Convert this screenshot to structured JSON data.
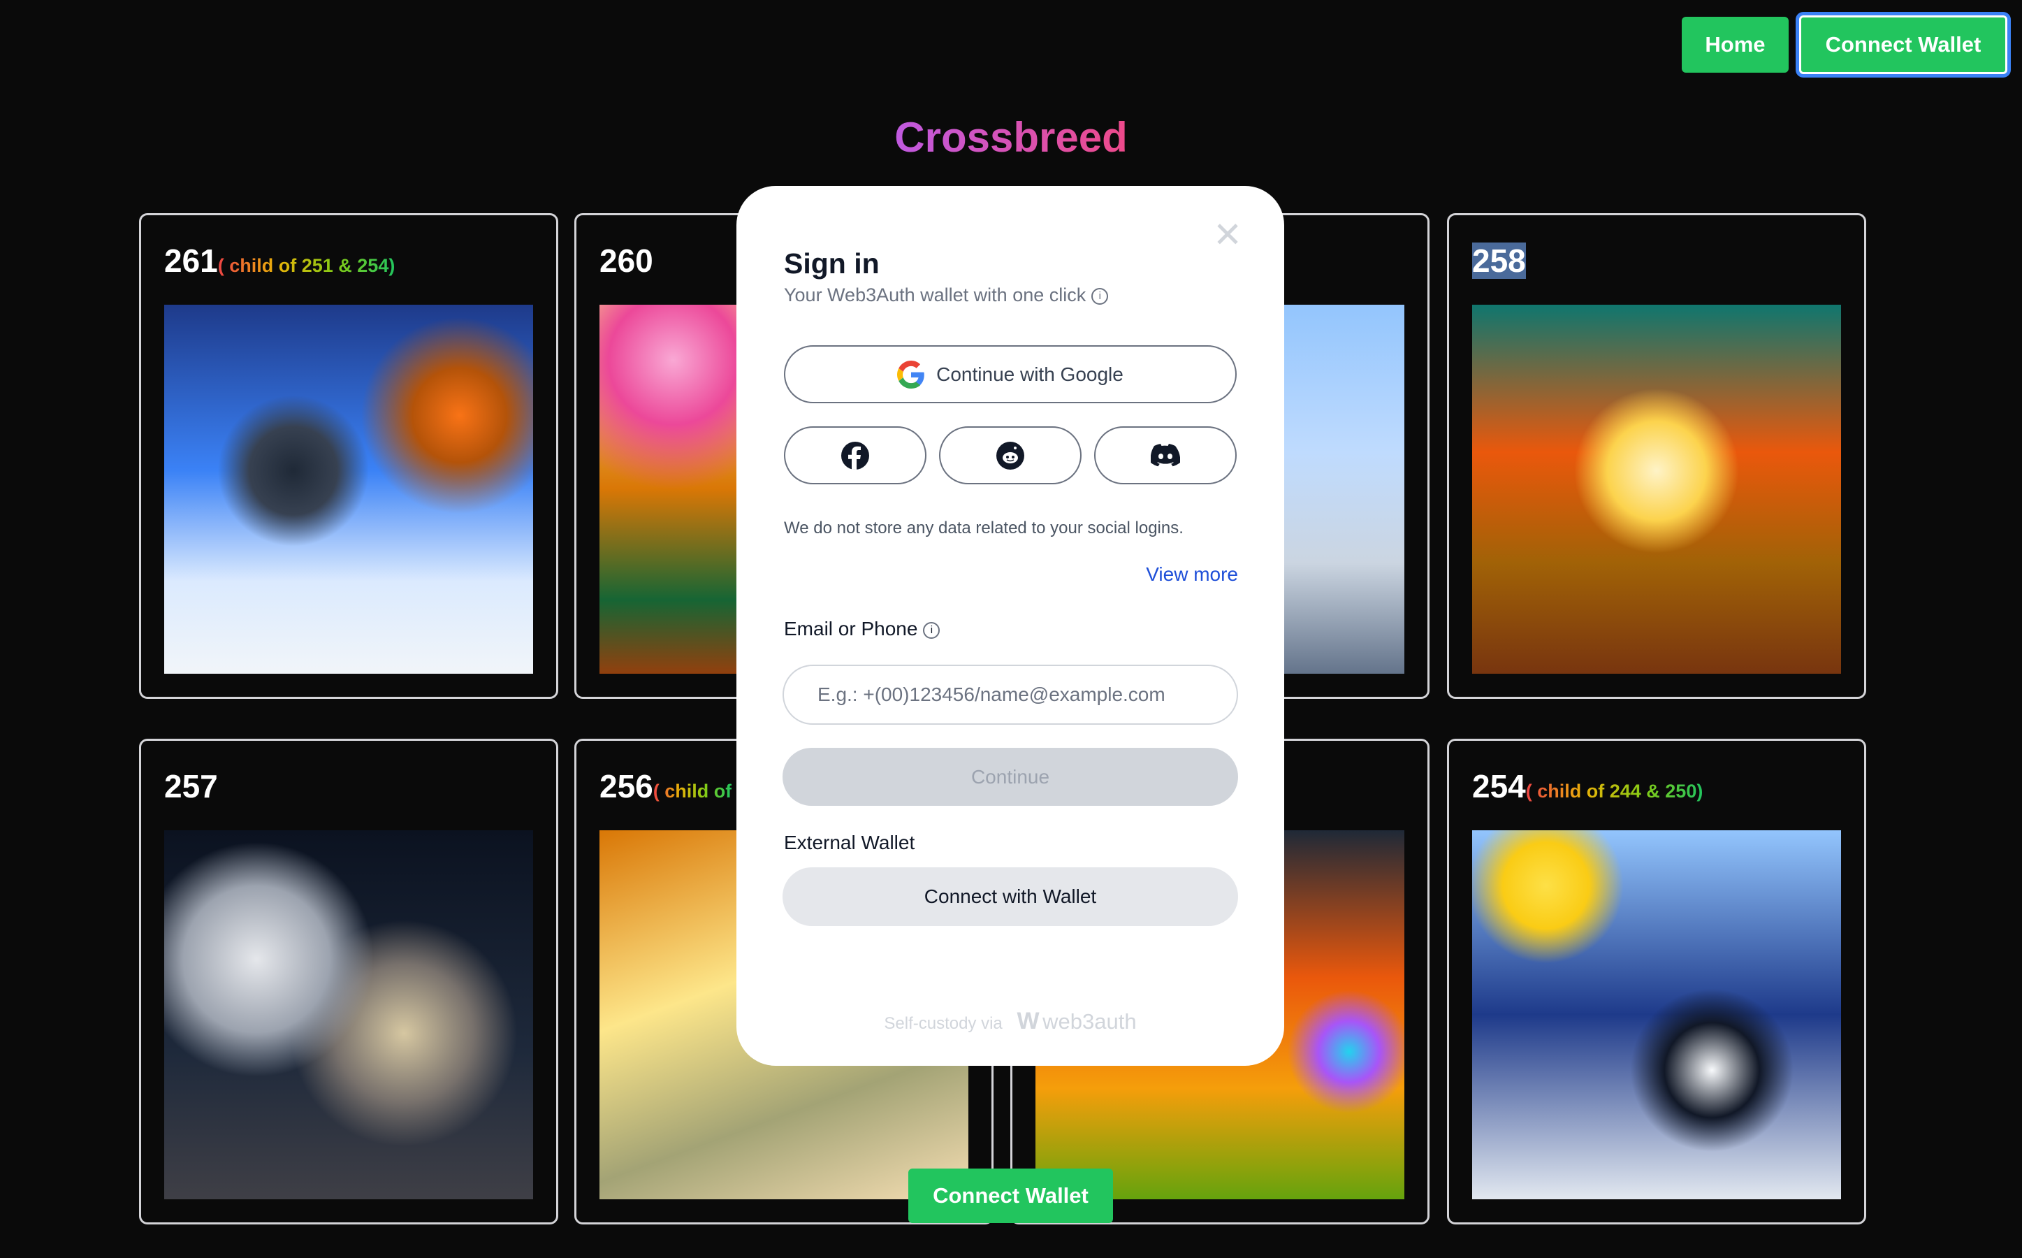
{
  "header": {
    "home_label": "Home",
    "connect_wallet_label": "Connect Wallet"
  },
  "title": "Crossbreed",
  "cards": [
    {
      "number": "261",
      "child_of": "( child of 251 & 254)"
    },
    {
      "number": "260",
      "child_of": ""
    },
    {
      "number": "",
      "child_of": ""
    },
    {
      "number": "258",
      "child_of": ""
    },
    {
      "number": "257",
      "child_of": ""
    },
    {
      "number": "256",
      "child_of": "( child of"
    },
    {
      "number": "",
      "child_of": ""
    },
    {
      "number": "254",
      "child_of": "( child of 244 & 250)"
    }
  ],
  "modal": {
    "title": "Sign in",
    "subtitle": "Your Web3Auth wallet with one click",
    "google_label": "Continue with Google",
    "social_icons": [
      "facebook-icon",
      "reddit-icon",
      "discord-icon"
    ],
    "disclaimer": "We do not store any data related to your social logins.",
    "view_more": "View more",
    "email_label": "Email or Phone",
    "email_placeholder": "E.g.: +(00)123456/name@example.com",
    "continue_label": "Continue",
    "external_wallet_label": "External Wallet",
    "connect_with_wallet_label": "Connect with Wallet",
    "footer_text": "Self-custody via",
    "footer_brand": "web3auth"
  },
  "bottom_connect_wallet_label": "Connect Wallet",
  "colors": {
    "accent_green": "#22c55e",
    "link_blue": "#1d4ed8"
  }
}
